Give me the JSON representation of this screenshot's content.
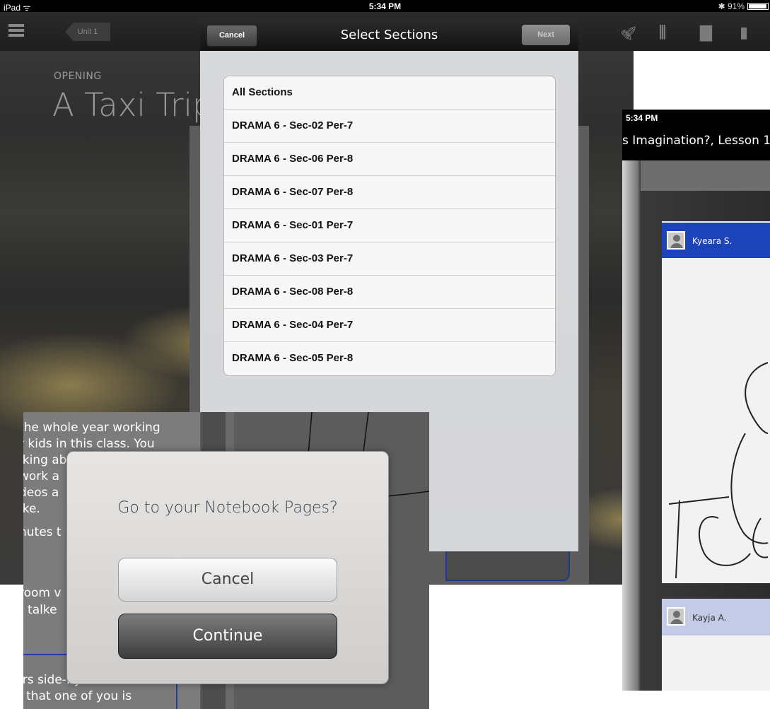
{
  "status_bar": {
    "device": "iPad",
    "time": "5:34 PM",
    "battery": "91%"
  },
  "app_bar": {
    "back_label": "Unit 1"
  },
  "lesson": {
    "label": "OPENING",
    "title": "A Taxi Trip"
  },
  "sections_modal": {
    "cancel_label": "Cancel",
    "title": "Select Sections",
    "next_label": "Next",
    "items": [
      "All Sections",
      "DRAMA 6 - Sec-02 Per-7",
      "DRAMA 6 - Sec-06 Per-8",
      "DRAMA 6 - Sec-07 Per-8",
      "DRAMA 6 - Sec-01 Per-7",
      "DRAMA 6 - Sec-03 Per-7",
      "DRAMA 6 - Sec-08 Per-8",
      "DRAMA 6 - Sec-04 Per-7",
      "DRAMA 6 - Sec-05 Per-8"
    ]
  },
  "right_screenshot": {
    "time": "5:34 PM",
    "title": "s Imagination?, Lesson 1",
    "student1": "Kyeara S.",
    "student2": "Kayja A."
  },
  "notebook_alert": {
    "text_lines": [
      "the whole year working",
      "r kids in this class. You",
      "lking ab",
      "work a",
      "deos a",
      "ike.",
      "nutes t",
      "room v",
      ") talke",
      "irs side-by-side.",
      "l that one of you is"
    ],
    "question": "Go to your Notebook Pages?",
    "cancel_label": "Cancel",
    "continue_label": "Continue"
  },
  "colors": {
    "accent_blue": "#1c43b8",
    "nav_bar": "#1a1a1a",
    "modal_bg": "#d7d8db"
  }
}
